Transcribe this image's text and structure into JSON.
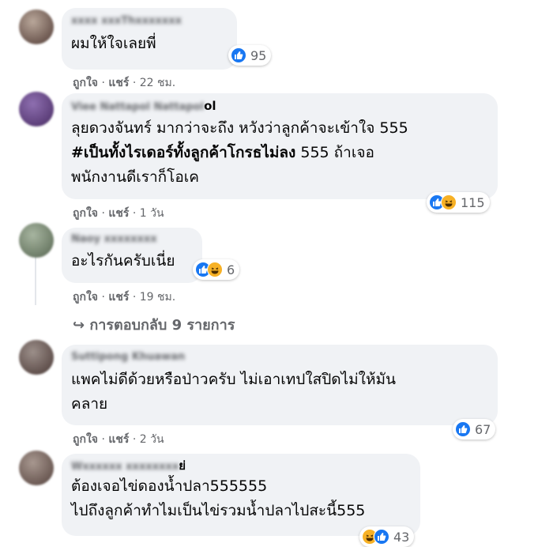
{
  "comments": [
    {
      "author": "xxxx xxxThxxxxxxx",
      "text": "ผมให้ใจเลยพี่",
      "reactions": {
        "count": "95",
        "types": [
          "like"
        ]
      },
      "meta": {
        "like": "ถูกใจ",
        "share": "แชร์",
        "time": "22 ชม."
      }
    },
    {
      "author": "Viee Nattapol Nattapol",
      "author_tail": "ol",
      "text_parts": [
        "ลุยดวงจันทร์ มากว่าจะถึง หวังว่าลูกค้าจะเข้าใจ 555\n",
        "#เป็นทั้งไรเดอร์ทั้งลูกค้าโกรธไม่ลง",
        " 555 ถ้าเจอ\nพนักงานดีเราก็โอเค"
      ],
      "reactions": {
        "count": "115",
        "types": [
          "like",
          "haha"
        ]
      },
      "meta": {
        "like": "ถูกใจ",
        "share": "แชร์",
        "time": "1 วัน"
      }
    },
    {
      "author": "Naoy xxxxxxxx",
      "text": "อะไรกันครับเนี่ย",
      "reactions": {
        "count": "6",
        "types": [
          "like",
          "haha"
        ]
      },
      "meta": {
        "like": "ถูกใจ",
        "share": "แชร์",
        "time": "19 ชม."
      },
      "replies": "↪ การตอบกลับ 9 รายการ"
    },
    {
      "author": "Suttipong Khuawan",
      "text": "แพคไม่ดีด้วยหรือป่าวครับ ไม่เอาเทปใสปิดไม่ให้มัน\nคลาย",
      "reactions": {
        "count": "67",
        "types": [
          "like"
        ]
      },
      "meta": {
        "like": "ถูกใจ",
        "share": "แชร์",
        "time": "2 วัน"
      }
    },
    {
      "author": "Wxxxxxx xxxxxxxx",
      "author_tail": "ย่",
      "text": "ต้องเจอไข่ดองน้ำปลา555555\nไปถึงลูกค้าทำไมเป็นไข่รวมน้ำปลาไปสะนี้555",
      "reactions": {
        "count": "43",
        "types": [
          "haha",
          "like"
        ]
      }
    }
  ],
  "sep": "·",
  "colors": {
    "bubble": "#f0f2f5",
    "meta": "#65676b",
    "like": "#1877f2",
    "haha": "#f7b125"
  }
}
